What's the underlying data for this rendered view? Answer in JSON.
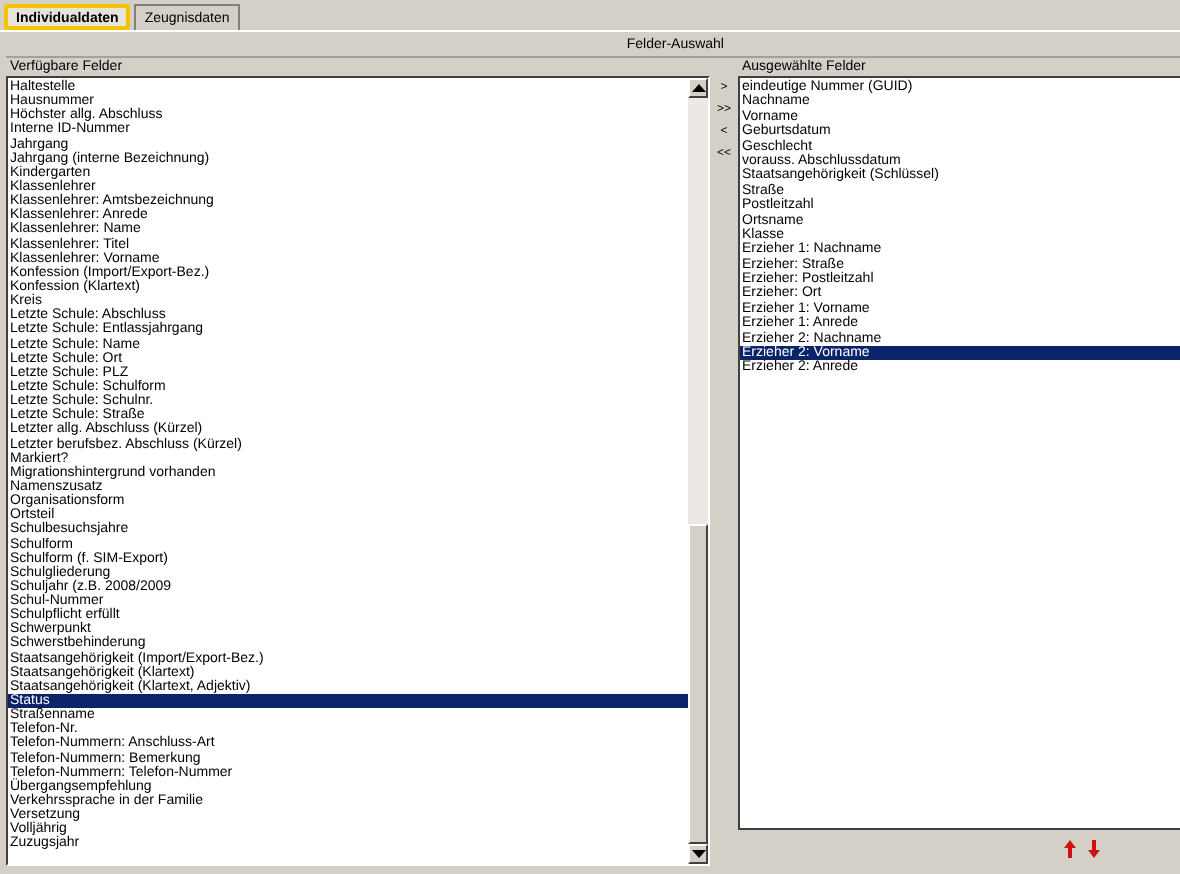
{
  "tabs": [
    {
      "label": "Individualdaten",
      "selected": true
    },
    {
      "label": "Zeugnisdaten",
      "selected": false
    }
  ],
  "group_title": "Felder-Auswahl",
  "available": {
    "label": "Verfügbare Felder",
    "items": [
      {
        "label": "Haltestelle",
        "selected": false
      },
      {
        "label": "Hausnummer",
        "selected": false
      },
      {
        "label": "Höchster allg. Abschluss",
        "selected": false
      },
      {
        "label": "Interne ID-Nummer",
        "selected": false
      },
      {
        "label": "Jahrgang",
        "selected": false
      },
      {
        "label": "Jahrgang (interne Bezeichnung)",
        "selected": false
      },
      {
        "label": "Kindergarten",
        "selected": false
      },
      {
        "label": "Klassenlehrer",
        "selected": false
      },
      {
        "label": "Klassenlehrer: Amtsbezeichnung",
        "selected": false
      },
      {
        "label": "Klassenlehrer: Anrede",
        "selected": false
      },
      {
        "label": "Klassenlehrer: Name",
        "selected": false
      },
      {
        "label": "Klassenlehrer: Titel",
        "selected": false
      },
      {
        "label": "Klassenlehrer: Vorname",
        "selected": false
      },
      {
        "label": "Konfession (Import/Export-Bez.)",
        "selected": false
      },
      {
        "label": "Konfession (Klartext)",
        "selected": false
      },
      {
        "label": "Kreis",
        "selected": false
      },
      {
        "label": "Letzte Schule: Abschluss",
        "selected": false
      },
      {
        "label": "Letzte Schule: Entlassjahrgang",
        "selected": false
      },
      {
        "label": "Letzte Schule: Name",
        "selected": false
      },
      {
        "label": "Letzte Schule: Ort",
        "selected": false
      },
      {
        "label": "Letzte Schule: PLZ",
        "selected": false
      },
      {
        "label": "Letzte Schule: Schulform",
        "selected": false
      },
      {
        "label": "Letzte Schule: Schulnr.",
        "selected": false
      },
      {
        "label": "Letzte Schule: Straße",
        "selected": false
      },
      {
        "label": "Letzter allg. Abschluss (Kürzel)",
        "selected": false
      },
      {
        "label": "Letzter berufsbez. Abschluss (Kürzel)",
        "selected": false
      },
      {
        "label": "Markiert?",
        "selected": false
      },
      {
        "label": "Migrationshintergrund vorhanden",
        "selected": false
      },
      {
        "label": "Namenszusatz",
        "selected": false
      },
      {
        "label": "Organisationsform",
        "selected": false
      },
      {
        "label": "Ortsteil",
        "selected": false
      },
      {
        "label": "Schulbesuchsjahre",
        "selected": false
      },
      {
        "label": "Schulform",
        "selected": false
      },
      {
        "label": "Schulform (f. SIM-Export)",
        "selected": false
      },
      {
        "label": "Schulgliederung",
        "selected": false
      },
      {
        "label": "Schuljahr (z.B. 2008/2009",
        "selected": false
      },
      {
        "label": "Schul-Nummer",
        "selected": false
      },
      {
        "label": "Schulpflicht erfüllt",
        "selected": false
      },
      {
        "label": "Schwerpunkt",
        "selected": false
      },
      {
        "label": "Schwerstbehinderung",
        "selected": false
      },
      {
        "label": "Staatsangehörigkeit (Import/Export-Bez.)",
        "selected": false
      },
      {
        "label": "Staatsangehörigkeit (Klartext)",
        "selected": false
      },
      {
        "label": "Staatsangehörigkeit (Klartext, Adjektiv)",
        "selected": false
      },
      {
        "label": "Status",
        "selected": true
      },
      {
        "label": "Straßenname",
        "selected": false
      },
      {
        "label": "Telefon-Nr.",
        "selected": false
      },
      {
        "label": "Telefon-Nummern: Anschluss-Art",
        "selected": false
      },
      {
        "label": "Telefon-Nummern: Bemerkung",
        "selected": false
      },
      {
        "label": "Telefon-Nummern: Telefon-Nummer",
        "selected": false
      },
      {
        "label": "Übergangsempfehlung",
        "selected": false
      },
      {
        "label": "Verkehrssprache in der Familie",
        "selected": false
      },
      {
        "label": "Versetzung",
        "selected": false
      },
      {
        "label": "Volljährig",
        "selected": false
      },
      {
        "label": "Zuzugsjahr",
        "selected": false
      }
    ]
  },
  "move_buttons": [
    ">",
    ">>",
    "<",
    "<<"
  ],
  "chosen": {
    "label": "Ausgewählte Felder",
    "items": [
      {
        "label": "eindeutige Nummer (GUID)",
        "selected": false
      },
      {
        "label": "Nachname",
        "selected": false
      },
      {
        "label": "Vorname",
        "selected": false
      },
      {
        "label": "Geburtsdatum",
        "selected": false
      },
      {
        "label": "Geschlecht",
        "selected": false
      },
      {
        "label": "vorauss. Abschlussdatum",
        "selected": false
      },
      {
        "label": "Staatsangehörigkeit (Schlüssel)",
        "selected": false
      },
      {
        "label": "Straße",
        "selected": false
      },
      {
        "label": "Postleitzahl",
        "selected": false
      },
      {
        "label": "Ortsname",
        "selected": false
      },
      {
        "label": "Klasse",
        "selected": false
      },
      {
        "label": "Erzieher 1: Nachname",
        "selected": false
      },
      {
        "label": "Erzieher: Straße",
        "selected": false
      },
      {
        "label": "Erzieher: Postleitzahl",
        "selected": false
      },
      {
        "label": "Erzieher: Ort",
        "selected": false
      },
      {
        "label": "Erzieher 1: Vorname",
        "selected": false
      },
      {
        "label": "Erzieher 1: Anrede",
        "selected": false
      },
      {
        "label": "Erzieher 2: Nachname",
        "selected": false
      },
      {
        "label": "Erzieher 2: Vorname",
        "selected": true
      },
      {
        "label": "Erzieher 2: Anrede",
        "selected": false
      }
    ]
  }
}
